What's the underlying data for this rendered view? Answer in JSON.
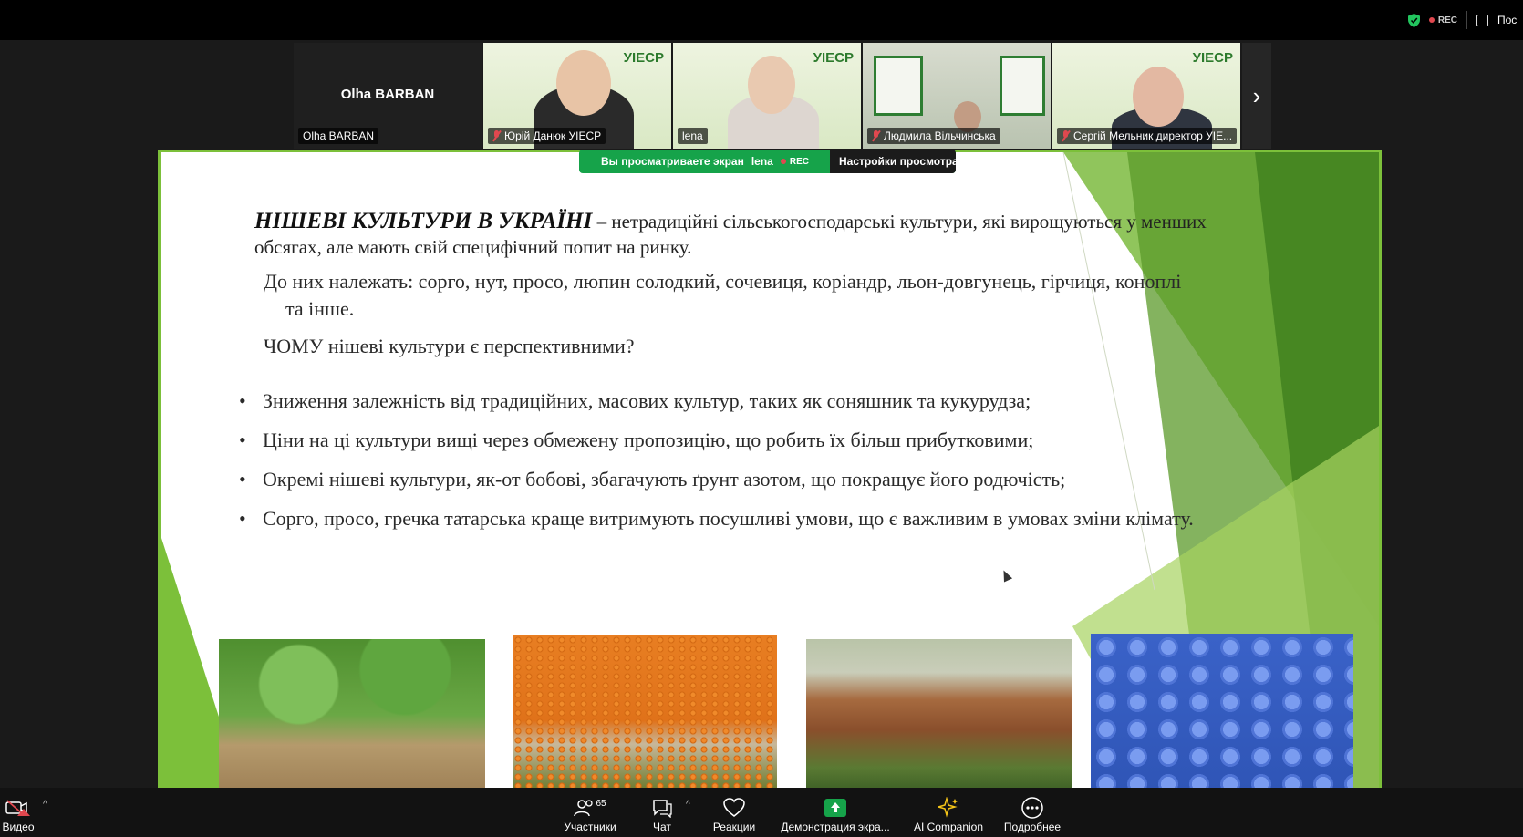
{
  "top_right": {
    "rec": "REC",
    "cut_label": "Пос"
  },
  "participants_strip": [
    {
      "name": "Olha BARBAN",
      "label": "Olha BARBAN",
      "type": "name-only"
    },
    {
      "label": "Юрій Данюк УІЕСР",
      "muted": true,
      "logo": "УІЕСР"
    },
    {
      "label": "lena",
      "muted": false,
      "logo": "УІЕСР"
    },
    {
      "label": "Людмила Вільчинська",
      "muted": true
    },
    {
      "label": "Сергій Мельник директор УІЕ...",
      "muted": true,
      "logo": "УІЕСР"
    }
  ],
  "share_bar": {
    "message": "Вы просматриваете экран",
    "sharer": "lena",
    "rec": "REC",
    "settings": "Настройки просмотра"
  },
  "slide": {
    "title_bold": "НІШЕВІ КУЛЬТУРИ В УКРАЇНІ",
    "title_rest": " – нетрадиційні сільськогосподарські культури, які вирощуються у менших обсягах, але мають свій специфічний попит на ринку.",
    "belong": "До них належать: сорго, нут, просо, люпин солодкий, сочевиця, коріандр, льон-довгунець, гірчиця, коноплі",
    "belong_cont": "та інше.",
    "question": "ЧОМУ нішеві культури є перспективними?",
    "bullets": [
      "Зниження залежність від традиційних, масових культур, таких як соняшник та кукурудза;",
      "Ціни на ці культури вищі через обмежену пропозицію, що робить їх більш прибутковими;",
      "Окремі нішеві культури, як-от бобові, збагачують ґрунт азотом, що покращує його родючість;",
      "Сорго, просо, гречка татарська краще витримують посушливі умови, що є важливим в умовах зміни клімату."
    ]
  },
  "toolbar": {
    "video": "Видео",
    "participants": "Участники",
    "participants_count": "65",
    "chat": "Чат",
    "reactions": "Реакции",
    "share": "Демонстрация экра...",
    "ai": "AI Companion",
    "more": "Подробнее"
  },
  "colors": {
    "slide_green": "#7cc03a",
    "share_green": "#16a34a",
    "rec_red": "#e0484f"
  }
}
